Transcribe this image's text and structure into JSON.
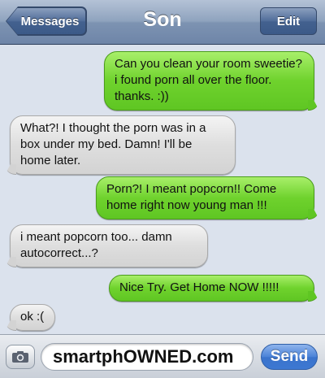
{
  "navbar": {
    "back_label": "Messages",
    "title": "Son",
    "edit_label": "Edit"
  },
  "messages": [
    {
      "direction": "sent",
      "text": "Can you clean your room sweetie? i found porn all over the floor. thanks. :))"
    },
    {
      "direction": "received",
      "text": "What?! I thought the porn was in a box under my bed. Damn! I'll be home later."
    },
    {
      "direction": "sent",
      "text": "Porn?! I meant popcorn!! Come home right now young man !!!"
    },
    {
      "direction": "received",
      "text": "i meant popcorn too... damn autocorrect...?"
    },
    {
      "direction": "sent",
      "text": "Nice Try. Get Home NOW !!!!!"
    },
    {
      "direction": "received",
      "text": "ok :("
    }
  ],
  "input": {
    "value": "smartphOWNED.com",
    "send_label": "Send",
    "camera_icon": "camera-icon"
  },
  "colors": {
    "sent_bubble": "#6fd22d",
    "received_bubble": "#dedede",
    "send_button": "#3d78d2"
  }
}
